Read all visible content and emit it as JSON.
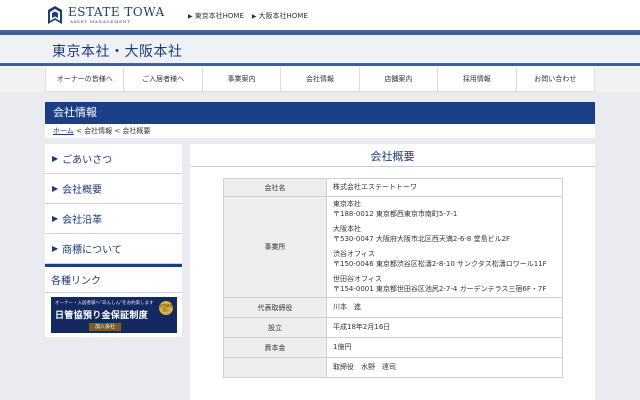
{
  "header": {
    "logo_main": "ESTATE TOWA",
    "logo_sub": "ASSET MANAGEMENT",
    "links": [
      "東京本社HOME",
      "大阪本社HOME"
    ]
  },
  "hero": {
    "title": "東京本社・大阪本社"
  },
  "nav": {
    "items": [
      "オーナーの皆様へ",
      "ご入居者様へ",
      "事業案内",
      "会社情報",
      "店舗案内",
      "採用情報",
      "お問い合わせ"
    ]
  },
  "section": {
    "title": "会社情報",
    "breadcrumb": {
      "home": "ホーム",
      "rest": " < 会社情報 < 会社概要"
    }
  },
  "sidebar": {
    "items": [
      "ごあいさつ",
      "会社概要",
      "会社沿革",
      "商標について"
    ],
    "links_heading": "各種リンク",
    "banner": {
      "top": "オーナー・入居者様へ\"あんしん\"をお約束します",
      "main": "日管協預り金保証制度",
      "bottom": "加入会社",
      "seal": "賃貸管理 加入"
    }
  },
  "main": {
    "title": "会社概要",
    "rows": {
      "company": {
        "label": "会社名",
        "value": "株式会社エステートトーワ"
      },
      "offices_label": "事業所",
      "offices": [
        {
          "name": "東京本社",
          "addr": "〒188-0012 東京都西東京市南町5-7-1"
        },
        {
          "name": "大阪本社",
          "addr": "〒530-0047 大阪府大阪市北区西天満2-6-8 堂島ビル2F"
        },
        {
          "name": "渋谷オフィス",
          "addr": "〒150-0046 東京都渋谷区松濤2-8-10 サンクタス松濤ロワール11F"
        },
        {
          "name": "世田谷オフィス",
          "addr": "〒154-0001 東京都世田谷区池尻2-7-4 ガーデンテラス三宿6F・7F"
        }
      ],
      "ceo": {
        "label": "代表取締役",
        "value": "川本　進"
      },
      "founded": {
        "label": "設立",
        "value": "平成18年2月16日"
      },
      "capital": {
        "label": "資本金",
        "value": "1億円"
      },
      "officers": {
        "label": "",
        "value": "取締役　水野　達司"
      }
    }
  },
  "colors": {
    "brand_navy": "#1b3f86",
    "page_bg": "#e9ebf0"
  }
}
